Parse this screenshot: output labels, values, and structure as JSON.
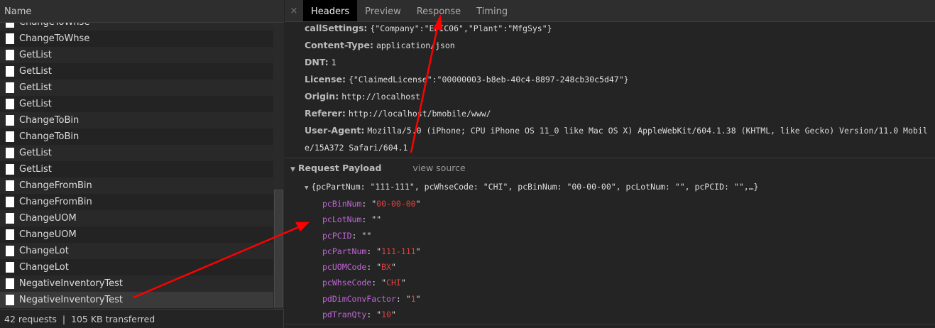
{
  "network": {
    "column_header": "Name",
    "rows": [
      "ChangeToWhse",
      "ChangeToWhse",
      "GetList",
      "GetList",
      "GetList",
      "GetList",
      "ChangeToBin",
      "ChangeToBin",
      "GetList",
      "GetList",
      "ChangeFromBin",
      "ChangeFromBin",
      "ChangeUOM",
      "ChangeUOM",
      "ChangeLot",
      "ChangeLot",
      "NegativeInventoryTest",
      "NegativeInventoryTest"
    ],
    "status": "42 requests  |  105 KB transferred"
  },
  "tabs": [
    "Headers",
    "Preview",
    "Response",
    "Timing"
  ],
  "close_icon": "×",
  "headers": [
    {
      "k": "callSettings:",
      "v": "{\"Company\":\"EPIC06\",\"Plant\":\"MfgSys\"}"
    },
    {
      "k": "Content-Type:",
      "v": "application/json"
    },
    {
      "k": "DNT:",
      "v": "1"
    },
    {
      "k": "License:",
      "v": "{\"ClaimedLicense\":\"00000003-b8eb-40c4-8897-248cb30c5d47\"}"
    },
    {
      "k": "Origin:",
      "v": "http://localhost"
    },
    {
      "k": "Referer:",
      "v": "http://localhost/bmobile/www/"
    },
    {
      "k": "User-Agent:",
      "v": "Mozilla/5.0 (iPhone; CPU iPhone OS 11_0 like Mac OS X) AppleWebKit/604.1.38 (KHTML, like Gecko) Version/11.0 Mobile/15A372 Safari/604.1"
    }
  ],
  "payload": {
    "title": "Request Payload",
    "view_source": "view source",
    "summary": "{pcPartNum: \"111-111\", pcWhseCode: \"CHI\", pcBinNum: \"00-00-00\", pcLotNum: \"\", pcPCID: \"\",…}",
    "props": [
      {
        "k": "pcBinNum",
        "v": "00-00-00"
      },
      {
        "k": "pcLotNum",
        "v": ""
      },
      {
        "k": "pcPCID",
        "v": ""
      },
      {
        "k": "pcPartNum",
        "v": "111-111"
      },
      {
        "k": "pcUOMCode",
        "v": "BX"
      },
      {
        "k": "pcWhseCode",
        "v": "CHI"
      },
      {
        "k": "pdDimConvFactor",
        "v": "1"
      },
      {
        "k": "pdTranQty",
        "v": "10"
      }
    ]
  },
  "annotation_color": "#ff0000"
}
